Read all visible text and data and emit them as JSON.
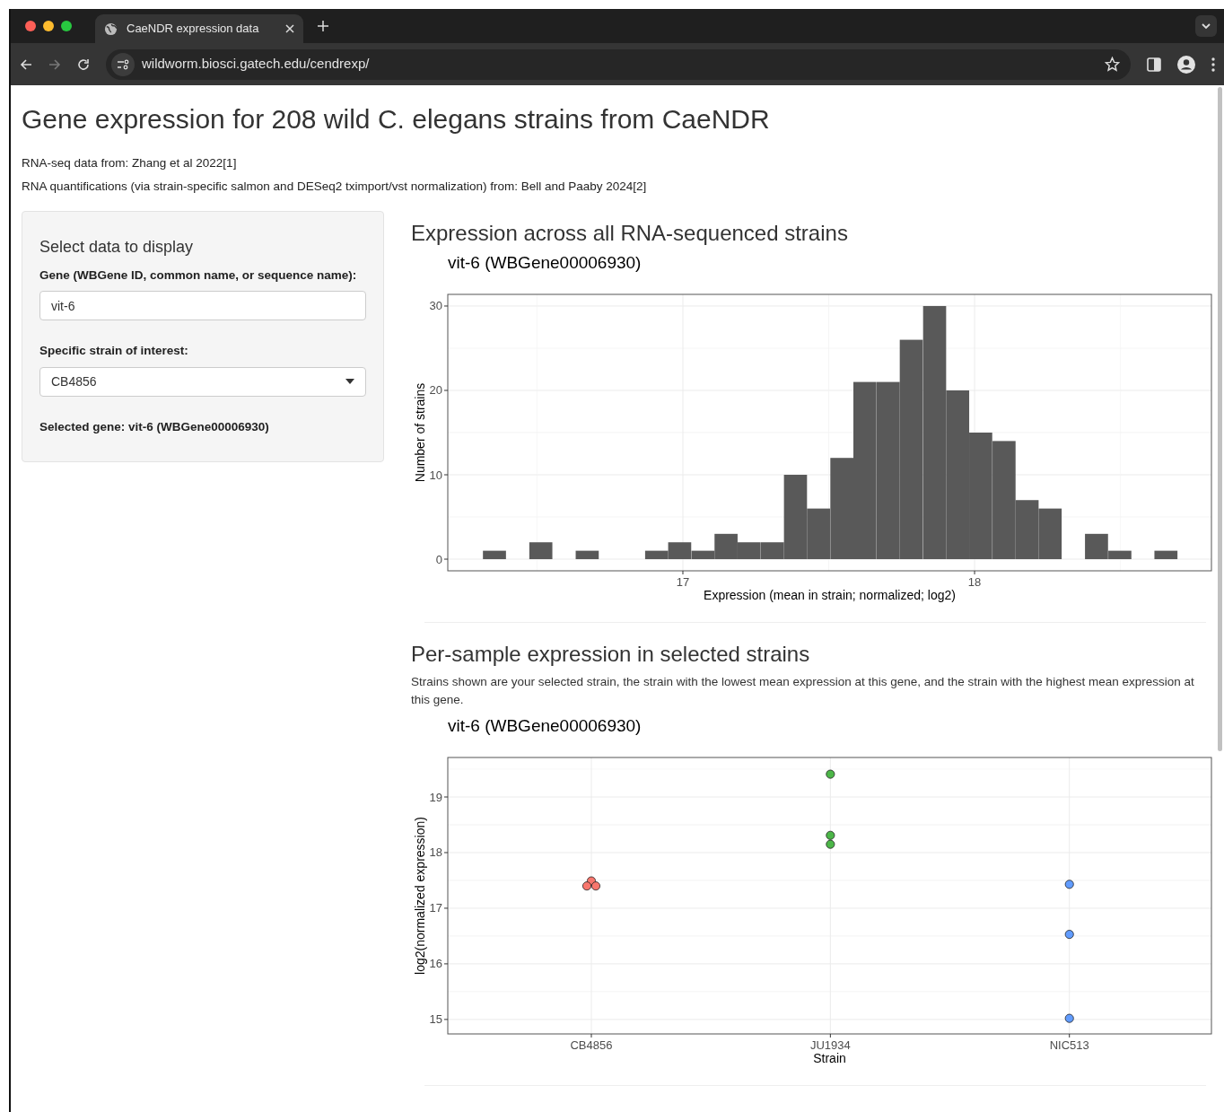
{
  "browser": {
    "tab_title": "CaeNDR expression data",
    "url": "wildworm.biosci.gatech.edu/cendrexp/"
  },
  "page": {
    "title": "Gene expression for 208 wild C. elegans strains from CaeNDR",
    "notes": [
      "RNA-seq data from: Zhang et al 2022[1]",
      "RNA quantifications (via strain-specific salmon and DESeq2 tximport/vst normalization) from: Bell and Paaby 2024[2]"
    ]
  },
  "sidebar": {
    "heading": "Select data to display",
    "gene_label": "Gene (WBGene ID, common name, or sequence name):",
    "gene_input": {
      "value": "vit-6"
    },
    "strain_label": "Specific strain of interest:",
    "strain_select": {
      "value": "CB4856"
    },
    "selected_gene": "Selected gene: vit-6 (WBGene00006930)"
  },
  "sections": [
    {
      "heading": "Expression across all RNA-sequenced strains",
      "chart_data": {
        "type": "bar",
        "title": "vit-6 (WBGene00006930)",
        "xlabel": "Expression (mean in strain; normalized; log2)",
        "ylabel": "Number of strains",
        "x": [
          16.354,
          16.433,
          16.513,
          16.592,
          16.672,
          16.751,
          16.83,
          16.91,
          16.989,
          17.069,
          17.148,
          17.227,
          17.307,
          17.386,
          17.465,
          17.545,
          17.624,
          17.704,
          17.783,
          17.863,
          17.942,
          18.021,
          18.101,
          18.18,
          18.259,
          18.339,
          18.418,
          18.498,
          18.577,
          18.656
        ],
        "values": [
          1,
          0,
          2,
          0,
          1,
          0,
          0,
          1,
          2,
          1,
          3,
          2,
          2,
          10,
          6,
          12,
          21,
          21,
          26,
          30,
          20,
          15,
          14,
          7,
          6,
          0,
          3,
          1,
          0,
          1
        ],
        "xlim": [
          16.194,
          18.812
        ],
        "ylim": [
          -1.38,
          31.38
        ],
        "xticks": [
          17,
          18
        ],
        "yticks": [
          0,
          10,
          20,
          30
        ],
        "grid": true
      }
    },
    {
      "heading": "Per-sample expression in selected strains",
      "description": "Strains shown are your selected strain, the strain with the lowest mean expression at this gene, and the strain with the highest mean expression at this gene.",
      "chart_data": {
        "type": "scatter",
        "title": "vit-6 (WBGene00006930)",
        "xlabel": "Strain",
        "ylabel": "log2(normalized expression)",
        "categories": [
          "CB4856",
          "JU1934",
          "NIC513"
        ],
        "series": [
          {
            "color": "#f8766d",
            "x": [
              "CB4856",
              "CB4856",
              "CB4856"
            ],
            "values": [
              17.49,
              17.4,
              17.4
            ]
          },
          {
            "color": "#4cb648",
            "x": [
              "JU1934",
              "JU1934",
              "JU1934"
            ],
            "values": [
              19.41,
              18.31,
              18.15
            ]
          },
          {
            "color": "#619cff",
            "x": [
              "NIC513",
              "NIC513",
              "NIC513"
            ],
            "values": [
              17.43,
              16.53,
              15.02
            ]
          }
        ],
        "ylim": [
          14.74,
          19.71
        ],
        "yticks": [
          15,
          16,
          17,
          18,
          19
        ],
        "grid": true
      }
    }
  ]
}
